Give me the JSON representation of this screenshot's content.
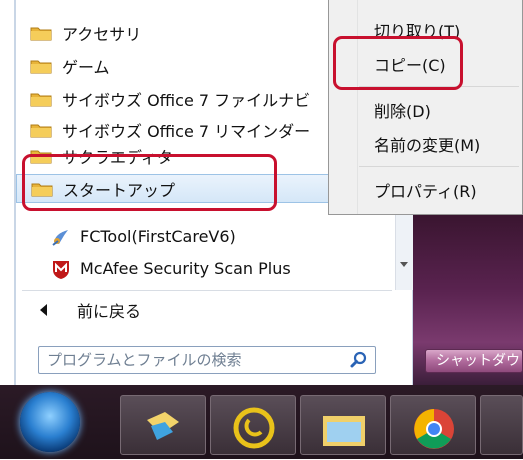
{
  "start_menu": {
    "programs": [
      {
        "label": "アクセサリ",
        "type": "folder"
      },
      {
        "label": "ゲーム",
        "type": "folder"
      },
      {
        "label": "サイボウズ Office 7 ファイルナビ",
        "type": "folder"
      },
      {
        "label": "サイボウズ Office 7 リマインダー",
        "type": "folder"
      },
      {
        "label": "サクラエディタ",
        "type": "folder"
      },
      {
        "label": "スタートアップ",
        "type": "folder",
        "selected": true
      },
      {
        "label": "FCTool(FirstCareV6)",
        "type": "app",
        "icon": "fctool-icon"
      },
      {
        "label": "McAfee Security Scan Plus",
        "type": "app",
        "icon": "mcafee-icon"
      }
    ],
    "back_label": "前に戻る",
    "search": {
      "placeholder": "プログラムとファイルの検索",
      "value": ""
    },
    "shutdown_label": "シャットダウン"
  },
  "context_menu": {
    "items": [
      {
        "label": "切り取り(T)"
      },
      {
        "label": "コピー(C)",
        "highlighted": true
      },
      {
        "label": "削除(D)"
      },
      {
        "label": "名前の変更(M)"
      },
      {
        "label": "プロパティ(R)"
      }
    ]
  },
  "colors": {
    "highlight_box": "#c8102e",
    "selected_item": "#d5e7f8",
    "taskbar": "#1e121b"
  }
}
